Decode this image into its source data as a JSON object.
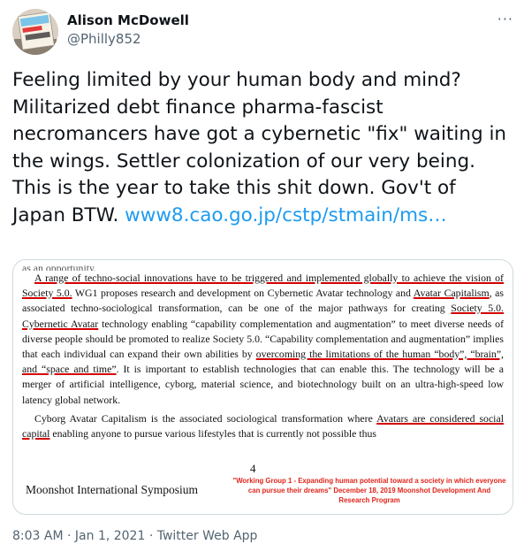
{
  "user": {
    "name": "Alison McDowell",
    "handle": "@Philly852",
    "avatar_sign_text": "TEACHERS AREN'T DRONES"
  },
  "tweet": {
    "text": "Feeling limited by your human body and mind? Militarized debt finance pharma-fascist necromancers have got a cybernetic \"fix\" waiting in the wings. Settler colonization of our very being. This is the year to take this shit down. Gov't of Japan BTW. ",
    "link": "www8.cao.go.jp/cstp/stmain/ms…"
  },
  "document": {
    "cut_line": "as an opportunity.",
    "p1": {
      "u1": "A range of techno-social innovations have to be triggered and implemented globally to achieve the vision of Society 5.0.",
      "t1": " WG1 proposes research and development on Cybernetic Avatar technology and ",
      "u2": "Avatar Capitalism",
      "t2": ", as associated techno-sociological transformation, can be one of the major pathways for creating ",
      "u3": "Society 5.0. Cybernetic Avatar",
      "t3": " technology enabling “capability complementation and augmentation” to meet diverse needs of diverse people should be promoted to realize Society 5.0. “Capability complementation and augmentation” implies that each individual can expand their own abilities by ",
      "u4": "overcoming the limitations of the human “body”, “brain”, and “space and time”",
      "t4": ". It is important to establish technologies that can enable this. The technology will be a merger of artificial intelligence, cyborg, material science, and biotechnology built on an ultra-high-speed low latency global network."
    },
    "p2": {
      "t1": "Cyborg Avatar Capitalism is the associated sociological transformation where ",
      "u1": "Avatars are considered social capital",
      "t2": " enabling anyone to pursue various lifestyles that is currently not possible thus"
    },
    "page_number": "4",
    "symposium": "Moonshot International Symposium",
    "caption": "\"Working Group 1 - Expanding human potential toward a society in which everyone can pursue their dreams\" December 18, 2019 Moonshot Development And Research Program"
  },
  "meta": {
    "time": "8:03 AM",
    "sep1": " · ",
    "date": "Jan 1, 2021",
    "sep2": " · ",
    "source": "Twitter Web App"
  },
  "colors": {
    "link": "#1d9bf0",
    "underline": "#d40000",
    "caption": "#e0251b",
    "secondary_text": "#536471"
  }
}
